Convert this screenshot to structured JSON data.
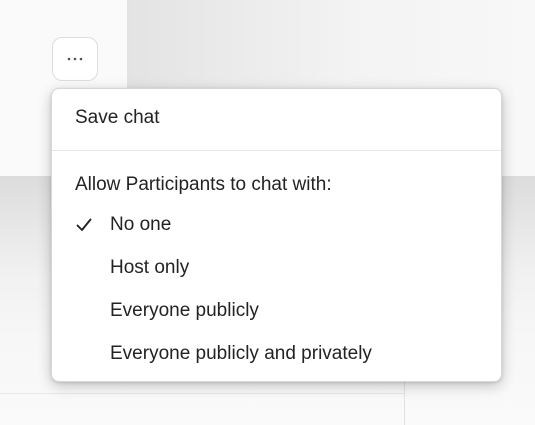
{
  "toolbar": {
    "more_icon": "ellipsis-icon"
  },
  "menu": {
    "save_chat": "Save chat",
    "section_label": "Allow Participants to chat with:",
    "options": [
      {
        "label": "No one",
        "checked": true
      },
      {
        "label": "Host only",
        "checked": false
      },
      {
        "label": "Everyone publicly",
        "checked": false
      },
      {
        "label": "Everyone publicly and privately",
        "checked": false
      }
    ],
    "check_icon": "checkmark-icon"
  }
}
